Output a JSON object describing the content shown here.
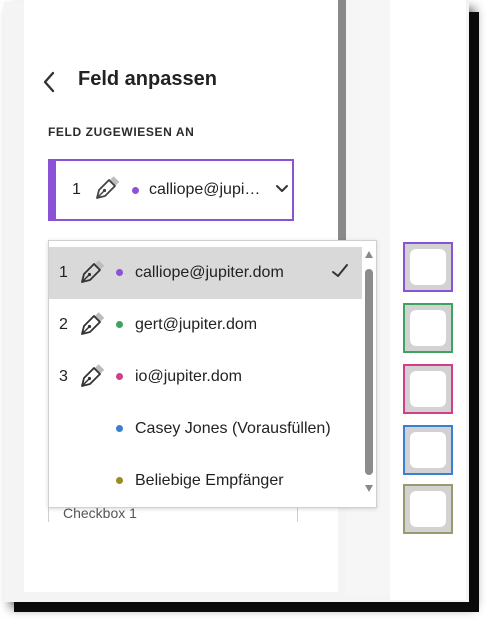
{
  "panel": {
    "title": "Feld anpassen",
    "section_label": "FELD ZUGEWIESEN AN"
  },
  "assigned_field": {
    "number": "1",
    "email": "calliope@jupi…",
    "color": "#8a52d4"
  },
  "dropdown": {
    "options": [
      {
        "number": "1",
        "label": "calliope@jupiter.dom",
        "color": "#8a52d4",
        "selected": true
      },
      {
        "number": "2",
        "label": "gert@jupiter.dom",
        "color": "#3ea35f",
        "selected": false
      },
      {
        "number": "3",
        "label": "io@jupiter.dom",
        "color": "#d63c8a",
        "selected": false
      },
      {
        "number": "",
        "label": "Casey Jones (Vorausfüllen)",
        "color": "#3a7fd6",
        "selected": false
      },
      {
        "number": "",
        "label": "Beliebige Empfänger",
        "color": "#9a8c1e",
        "selected": false
      }
    ]
  },
  "background_field_label": "Checkbox 1",
  "checkbox_fields": [
    {
      "border_color": "#8a52d4"
    },
    {
      "border_color": "#3ea35f"
    },
    {
      "border_color": "#d63c8a"
    },
    {
      "border_color": "#3a7fd6"
    },
    {
      "border_color": "#9a9a6a"
    }
  ],
  "icons": {
    "back": "chevron-left-icon",
    "pen": "pen-nib-icon",
    "dropdown": "chevron-down-icon",
    "check": "checkmark-icon"
  }
}
